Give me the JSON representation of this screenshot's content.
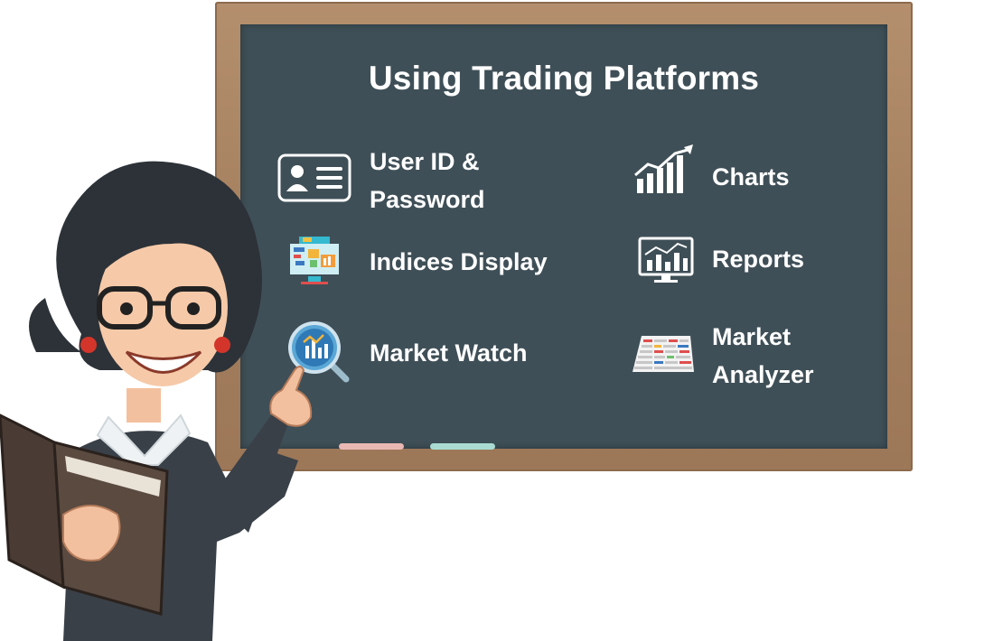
{
  "title": "Using Trading Platforms",
  "items": [
    {
      "line1": "User ID &",
      "line2": "Password",
      "icon": "id-card-icon"
    },
    {
      "label": "Indices Display",
      "icon": "monitor-dashboard-icon"
    },
    {
      "label": "Market Watch",
      "icon": "magnifier-chart-icon"
    },
    {
      "label": "Charts",
      "icon": "growth-chart-icon"
    },
    {
      "label": "Reports",
      "icon": "report-monitor-icon"
    },
    {
      "line1": "Market",
      "line2": "Analyzer",
      "icon": "spreadsheet-icon"
    }
  ],
  "colors": {
    "board": "#3f4f57",
    "frame": "#a5805f",
    "text": "#ffffff"
  }
}
